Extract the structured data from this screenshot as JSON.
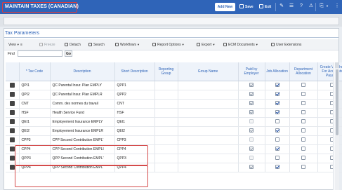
{
  "header": {
    "title": "MAINTAIN TAXES (CANADIAN)",
    "add_new": "Add New",
    "save": "Save",
    "exit": "Exit"
  },
  "panel": {
    "title": "Tax Parameters"
  },
  "toolbar": {
    "view": "View",
    "freeze": "Freeze",
    "detach": "Detach",
    "search": "Search",
    "workflows": "Workflows",
    "report_options": "Report Options",
    "export": "Export",
    "ecm_documents": "ECM Documents",
    "user_extensions": "User Extensions"
  },
  "find": {
    "label": "Find",
    "value": "",
    "go": "Go"
  },
  "table": {
    "columns": [
      "* Tax Code",
      "Description",
      "Short Description",
      "Reporting Group",
      "Group Name",
      "Paid by Employer",
      "Job Allocation",
      "Department Allocation",
      "Create Voucher For Accounts Payable"
    ],
    "rows": [
      {
        "tax_code": "QPI1",
        "description": "QC Parental Insur. Plan EMPLY",
        "short": "QPP1",
        "paid": true,
        "job": true,
        "dept": false,
        "voucher": false
      },
      {
        "tax_code": "QPI2",
        "description": "QC Parental Insur. Plan EMPLR",
        "short": "QPP2",
        "paid": true,
        "job": true,
        "dept": false,
        "voucher": false
      },
      {
        "tax_code": "CNT",
        "description": "Comm. des normes du travail",
        "short": "CNT",
        "paid": true,
        "job": true,
        "dept": false,
        "voucher": false
      },
      {
        "tax_code": "HSF",
        "description": "Health Service Fund",
        "short": "HSF",
        "paid": true,
        "job": true,
        "dept": false,
        "voucher": false
      },
      {
        "tax_code": "QEI1",
        "description": "Employement Insurance EMPLY",
        "short": "QEI1",
        "paid": false,
        "job": false,
        "dept": false,
        "voucher": false
      },
      {
        "tax_code": "QEI2",
        "description": "Employement Insurance EMPLR",
        "short": "QEI2",
        "paid": true,
        "job": true,
        "dept": false,
        "voucher": false
      },
      {
        "tax_code": "CPP3",
        "description": "CPP Second Contribution EMPL'",
        "short": "CPP3",
        "paid": false,
        "job": false,
        "dept": false,
        "voucher": false
      },
      {
        "tax_code": "CPP4",
        "description": "CPP Second Contribution EMPLI",
        "short": "CPP4",
        "paid": true,
        "job": true,
        "dept": false,
        "voucher": false
      },
      {
        "tax_code": "QPP3",
        "description": "QPP Second Contribution EMPL'",
        "short": "QPP3",
        "paid": false,
        "job": false,
        "dept": false,
        "voucher": false
      },
      {
        "tax_code": "QPP4",
        "description": "QPP Second Contribution EMPL",
        "short": "QPP4",
        "paid": true,
        "job": true,
        "dept": false,
        "voucher": false
      }
    ]
  }
}
